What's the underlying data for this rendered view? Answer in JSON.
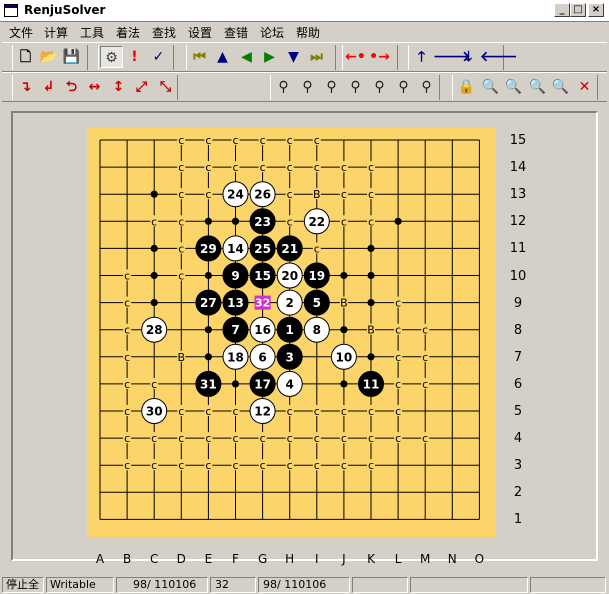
{
  "window": {
    "title": "RenjuSolver",
    "min_symbol": "_",
    "max_symbol": "□",
    "close_symbol": "×"
  },
  "menu": [
    "文件",
    "计算",
    "工具",
    "着法",
    "查找",
    "设置",
    "查错",
    "论坛",
    "帮助"
  ],
  "toolbar1": [
    {
      "name": "new-file-icon",
      "glyph": "🗋",
      "color": "#000000"
    },
    {
      "name": "open-folder-icon",
      "glyph": "📂",
      "color": "#b08800"
    },
    {
      "name": "save-disk-icon",
      "glyph": "💾",
      "color": "#000080"
    },
    {
      "name": "solve-icon",
      "glyph": "⚙",
      "color": "#404040"
    },
    {
      "name": "exclamation-icon",
      "glyph": "!",
      "color": "#ff0000"
    },
    {
      "name": "check-icon",
      "glyph": "✓",
      "color": "#000080"
    },
    {
      "name": "first-move-icon",
      "glyph": "⏮",
      "color": "#808000"
    },
    {
      "name": "up-triangle-icon",
      "glyph": "▲",
      "color": "#000080"
    },
    {
      "name": "back-triangle-icon",
      "glyph": "◀",
      "color": "#008000"
    },
    {
      "name": "forward-triangle-icon",
      "glyph": "▶",
      "color": "#008000"
    },
    {
      "name": "down-triangle-icon",
      "glyph": "▼",
      "color": "#000080"
    },
    {
      "name": "last-move-icon",
      "glyph": "⏭",
      "color": "#808000"
    },
    {
      "name": "move-left-icon",
      "glyph": "←•",
      "color": "#ff0000"
    },
    {
      "name": "move-right-icon",
      "glyph": "•→",
      "color": "#ff0000"
    },
    {
      "name": "shift-up-icon",
      "glyph": "🡑",
      "color": "#000080"
    },
    {
      "name": "shift-right-icon",
      "glyph": "🡒",
      "color": "#000080"
    },
    {
      "name": "shift-down-icon",
      "glyph": "🡓",
      "color": "#000080"
    },
    {
      "name": "shift-left-icon",
      "glyph": "🡐",
      "color": "#000080"
    }
  ],
  "toolbar2": [
    {
      "name": "rotate-right-icon",
      "glyph": "↴",
      "color": "#cc0000"
    },
    {
      "name": "rotate-left-icon",
      "glyph": "↲",
      "color": "#cc0000"
    },
    {
      "name": "flip-vertical-icon",
      "glyph": "⮌",
      "color": "#cc0000"
    },
    {
      "name": "mirror-horizontal-icon",
      "glyph": "↔",
      "color": "#cc0000"
    },
    {
      "name": "mirror-vertical-icon",
      "glyph": "↕",
      "color": "#cc0000"
    },
    {
      "name": "mirror-diagonal-icon",
      "glyph": "⤢",
      "color": "#cc0000"
    },
    {
      "name": "mirror-antidiagonal-icon",
      "glyph": "⤡",
      "color": "#cc0000"
    },
    {
      "name": "search-binoculars-icon",
      "glyph": "⚲",
      "color": "#202020"
    },
    {
      "name": "search-binoculars-icon",
      "glyph": "⚲",
      "color": "#202020"
    },
    {
      "name": "search-binoculars-icon",
      "glyph": "⚲",
      "color": "#202020"
    },
    {
      "name": "search-binoculars-icon",
      "glyph": "⚲",
      "color": "#202020"
    },
    {
      "name": "search-binoculars-icon",
      "glyph": "⚲",
      "color": "#202020"
    },
    {
      "name": "search-binoculars-icon",
      "glyph": "⚲",
      "color": "#202020"
    },
    {
      "name": "search-binoculars-icon",
      "glyph": "⚲",
      "color": "#202020"
    },
    {
      "name": "lock-icon",
      "glyph": "🔒",
      "color": "#202020"
    },
    {
      "name": "zoom-red-icon",
      "glyph": "🔍",
      "color": "#cc0000"
    },
    {
      "name": "zoom-out-red-icon",
      "glyph": "🔍",
      "color": "#cc0000"
    },
    {
      "name": "zoom-blue-icon",
      "glyph": "🔍",
      "color": "#000080"
    },
    {
      "name": "zoom-in-blue-icon",
      "glyph": "🔍",
      "color": "#000080"
    },
    {
      "name": "close-red-icon",
      "glyph": "✕",
      "color": "#cc0000"
    }
  ],
  "board": {
    "size": 15,
    "column_labels": [
      "A",
      "B",
      "C",
      "D",
      "E",
      "F",
      "G",
      "H",
      "I",
      "J",
      "K",
      "L",
      "M",
      "N",
      "O"
    ],
    "row_labels": [
      "15",
      "14",
      "13",
      "12",
      "11",
      "10",
      "9",
      "8",
      "7",
      "6",
      "5",
      "4",
      "3",
      "2",
      "1"
    ],
    "colors": {
      "board": "#fcd56a",
      "line": "#000000",
      "black_stone": "#000000",
      "white_stone": "#ffffff",
      "last_move": "#cc33cc"
    },
    "stones": [
      {
        "col": "H",
        "row": 8,
        "num": "1",
        "color": "black"
      },
      {
        "col": "H",
        "row": 9,
        "num": "2",
        "color": "white"
      },
      {
        "col": "H",
        "row": 7,
        "num": "3",
        "color": "black"
      },
      {
        "col": "H",
        "row": 6,
        "num": "4",
        "color": "white"
      },
      {
        "col": "I",
        "row": 9,
        "num": "5",
        "color": "black"
      },
      {
        "col": "G",
        "row": 7,
        "num": "6",
        "color": "white"
      },
      {
        "col": "F",
        "row": 8,
        "num": "7",
        "color": "black"
      },
      {
        "col": "I",
        "row": 8,
        "num": "8",
        "color": "white"
      },
      {
        "col": "F",
        "row": 10,
        "num": "9",
        "color": "black"
      },
      {
        "col": "J",
        "row": 7,
        "num": "10",
        "color": "white"
      },
      {
        "col": "K",
        "row": 6,
        "num": "11",
        "color": "black"
      },
      {
        "col": "G",
        "row": 5,
        "num": "12",
        "color": "white"
      },
      {
        "col": "F",
        "row": 9,
        "num": "13",
        "color": "black"
      },
      {
        "col": "F",
        "row": 11,
        "num": "14",
        "color": "white"
      },
      {
        "col": "G",
        "row": 10,
        "num": "15",
        "color": "black"
      },
      {
        "col": "G",
        "row": 8,
        "num": "16",
        "color": "white"
      },
      {
        "col": "G",
        "row": 6,
        "num": "17",
        "color": "black"
      },
      {
        "col": "F",
        "row": 7,
        "num": "18",
        "color": "white"
      },
      {
        "col": "I",
        "row": 10,
        "num": "19",
        "color": "black"
      },
      {
        "col": "H",
        "row": 10,
        "num": "20",
        "color": "white"
      },
      {
        "col": "H",
        "row": 11,
        "num": "21",
        "color": "black"
      },
      {
        "col": "I",
        "row": 12,
        "num": "22",
        "color": "white"
      },
      {
        "col": "G",
        "row": 12,
        "num": "23",
        "color": "black"
      },
      {
        "col": "F",
        "row": 13,
        "num": "24",
        "color": "white"
      },
      {
        "col": "G",
        "row": 11,
        "num": "25",
        "color": "black"
      },
      {
        "col": "G",
        "row": 13,
        "num": "26",
        "color": "white"
      },
      {
        "col": "E",
        "row": 9,
        "num": "27",
        "color": "black"
      },
      {
        "col": "C",
        "row": 8,
        "num": "28",
        "color": "white"
      },
      {
        "col": "E",
        "row": 11,
        "num": "29",
        "color": "black"
      },
      {
        "col": "C",
        "row": 5,
        "num": "30",
        "color": "white"
      },
      {
        "col": "E",
        "row": 6,
        "num": "31",
        "color": "black"
      },
      {
        "col": "G",
        "row": 9,
        "num": "32",
        "color": "last"
      }
    ],
    "letter_marks": [
      {
        "col": "D",
        "row": 15,
        "text": "c"
      },
      {
        "col": "E",
        "row": 15,
        "text": "c"
      },
      {
        "col": "F",
        "row": 15,
        "text": "c"
      },
      {
        "col": "G",
        "row": 15,
        "text": "c"
      },
      {
        "col": "H",
        "row": 15,
        "text": "c"
      },
      {
        "col": "I",
        "row": 15,
        "text": "c"
      },
      {
        "col": "D",
        "row": 14,
        "text": "c"
      },
      {
        "col": "E",
        "row": 14,
        "text": "c"
      },
      {
        "col": "F",
        "row": 14,
        "text": "c"
      },
      {
        "col": "G",
        "row": 14,
        "text": "c"
      },
      {
        "col": "H",
        "row": 14,
        "text": "c"
      },
      {
        "col": "I",
        "row": 14,
        "text": "c"
      },
      {
        "col": "J",
        "row": 14,
        "text": "c"
      },
      {
        "col": "K",
        "row": 14,
        "text": "c"
      },
      {
        "col": "D",
        "row": 13,
        "text": "c"
      },
      {
        "col": "E",
        "row": 13,
        "text": "c"
      },
      {
        "col": "H",
        "row": 13,
        "text": "c"
      },
      {
        "col": "I",
        "row": 13,
        "text": "B"
      },
      {
        "col": "J",
        "row": 13,
        "text": "c"
      },
      {
        "col": "K",
        "row": 13,
        "text": "c"
      },
      {
        "col": "C",
        "row": 12,
        "text": "c"
      },
      {
        "col": "D",
        "row": 12,
        "text": "c"
      },
      {
        "col": "H",
        "row": 12,
        "text": "c"
      },
      {
        "col": "J",
        "row": 12,
        "text": "c"
      },
      {
        "col": "K",
        "row": 12,
        "text": "c"
      },
      {
        "col": "D",
        "row": 11,
        "text": "c"
      },
      {
        "col": "I",
        "row": 11,
        "text": "c"
      },
      {
        "col": "B",
        "row": 10,
        "text": "c"
      },
      {
        "col": "D",
        "row": 10,
        "text": "c"
      },
      {
        "col": "B",
        "row": 9,
        "text": "c"
      },
      {
        "col": "J",
        "row": 9,
        "text": "B"
      },
      {
        "col": "L",
        "row": 9,
        "text": "c"
      },
      {
        "col": "B",
        "row": 8,
        "text": "c"
      },
      {
        "col": "K",
        "row": 8,
        "text": "B"
      },
      {
        "col": "L",
        "row": 8,
        "text": "c"
      },
      {
        "col": "M",
        "row": 8,
        "text": "c"
      },
      {
        "col": "B",
        "row": 7,
        "text": "c"
      },
      {
        "col": "D",
        "row": 7,
        "text": "B"
      },
      {
        "col": "L",
        "row": 7,
        "text": "c"
      },
      {
        "col": "M",
        "row": 7,
        "text": "c"
      },
      {
        "col": "B",
        "row": 6,
        "text": "c"
      },
      {
        "col": "C",
        "row": 6,
        "text": "c"
      },
      {
        "col": "L",
        "row": 6,
        "text": "c"
      },
      {
        "col": "M",
        "row": 6,
        "text": "c"
      },
      {
        "col": "B",
        "row": 5,
        "text": "c"
      },
      {
        "col": "D",
        "row": 5,
        "text": "c"
      },
      {
        "col": "E",
        "row": 5,
        "text": "c"
      },
      {
        "col": "F",
        "row": 5,
        "text": "c"
      },
      {
        "col": "H",
        "row": 5,
        "text": "c"
      },
      {
        "col": "I",
        "row": 5,
        "text": "c"
      },
      {
        "col": "J",
        "row": 5,
        "text": "c"
      },
      {
        "col": "K",
        "row": 5,
        "text": "c"
      },
      {
        "col": "L",
        "row": 5,
        "text": "c"
      },
      {
        "col": "B",
        "row": 4,
        "text": "c"
      },
      {
        "col": "C",
        "row": 4,
        "text": "c"
      },
      {
        "col": "D",
        "row": 4,
        "text": "c"
      },
      {
        "col": "E",
        "row": 4,
        "text": "c"
      },
      {
        "col": "F",
        "row": 4,
        "text": "c"
      },
      {
        "col": "G",
        "row": 4,
        "text": "c"
      },
      {
        "col": "H",
        "row": 4,
        "text": "c"
      },
      {
        "col": "I",
        "row": 4,
        "text": "c"
      },
      {
        "col": "J",
        "row": 4,
        "text": "c"
      },
      {
        "col": "K",
        "row": 4,
        "text": "c"
      },
      {
        "col": "L",
        "row": 4,
        "text": "c"
      },
      {
        "col": "M",
        "row": 4,
        "text": "c"
      },
      {
        "col": "B",
        "row": 3,
        "text": "c"
      },
      {
        "col": "C",
        "row": 3,
        "text": "c"
      },
      {
        "col": "D",
        "row": 3,
        "text": "c"
      },
      {
        "col": "E",
        "row": 3,
        "text": "c"
      },
      {
        "col": "F",
        "row": 3,
        "text": "c"
      },
      {
        "col": "G",
        "row": 3,
        "text": "c"
      },
      {
        "col": "H",
        "row": 3,
        "text": "c"
      },
      {
        "col": "I",
        "row": 3,
        "text": "c"
      },
      {
        "col": "J",
        "row": 3,
        "text": "c"
      },
      {
        "col": "K",
        "row": 3,
        "text": "c"
      }
    ],
    "dot_marks": [
      {
        "col": "C",
        "row": 13
      },
      {
        "col": "E",
        "row": 12
      },
      {
        "col": "F",
        "row": 12
      },
      {
        "col": "L",
        "row": 12
      },
      {
        "col": "C",
        "row": 11
      },
      {
        "col": "K",
        "row": 11
      },
      {
        "col": "C",
        "row": 10
      },
      {
        "col": "E",
        "row": 10
      },
      {
        "col": "J",
        "row": 10
      },
      {
        "col": "K",
        "row": 10
      },
      {
        "col": "C",
        "row": 9
      },
      {
        "col": "K",
        "row": 9
      },
      {
        "col": "E",
        "row": 8
      },
      {
        "col": "J",
        "row": 8
      },
      {
        "col": "E",
        "row": 7
      },
      {
        "col": "K",
        "row": 7
      },
      {
        "col": "F",
        "row": 6
      },
      {
        "col": "J",
        "row": 6
      },
      {
        "col": "E",
        "row": 5
      },
      {
        "col": "K",
        "row": 5
      }
    ]
  },
  "statusbar": [
    {
      "text": "停止全",
      "name": "status-state"
    },
    {
      "text": "Writable",
      "name": "status-writable"
    },
    {
      "text": "98/  110106",
      "name": "status-count-1"
    },
    {
      "text": "32",
      "name": "status-move-number"
    },
    {
      "text": "98/  110106",
      "name": "status-count-2"
    },
    {
      "text": "",
      "name": "status-empty-1"
    },
    {
      "text": "",
      "name": "status-empty-2"
    },
    {
      "text": "",
      "name": "status-empty-3"
    }
  ]
}
